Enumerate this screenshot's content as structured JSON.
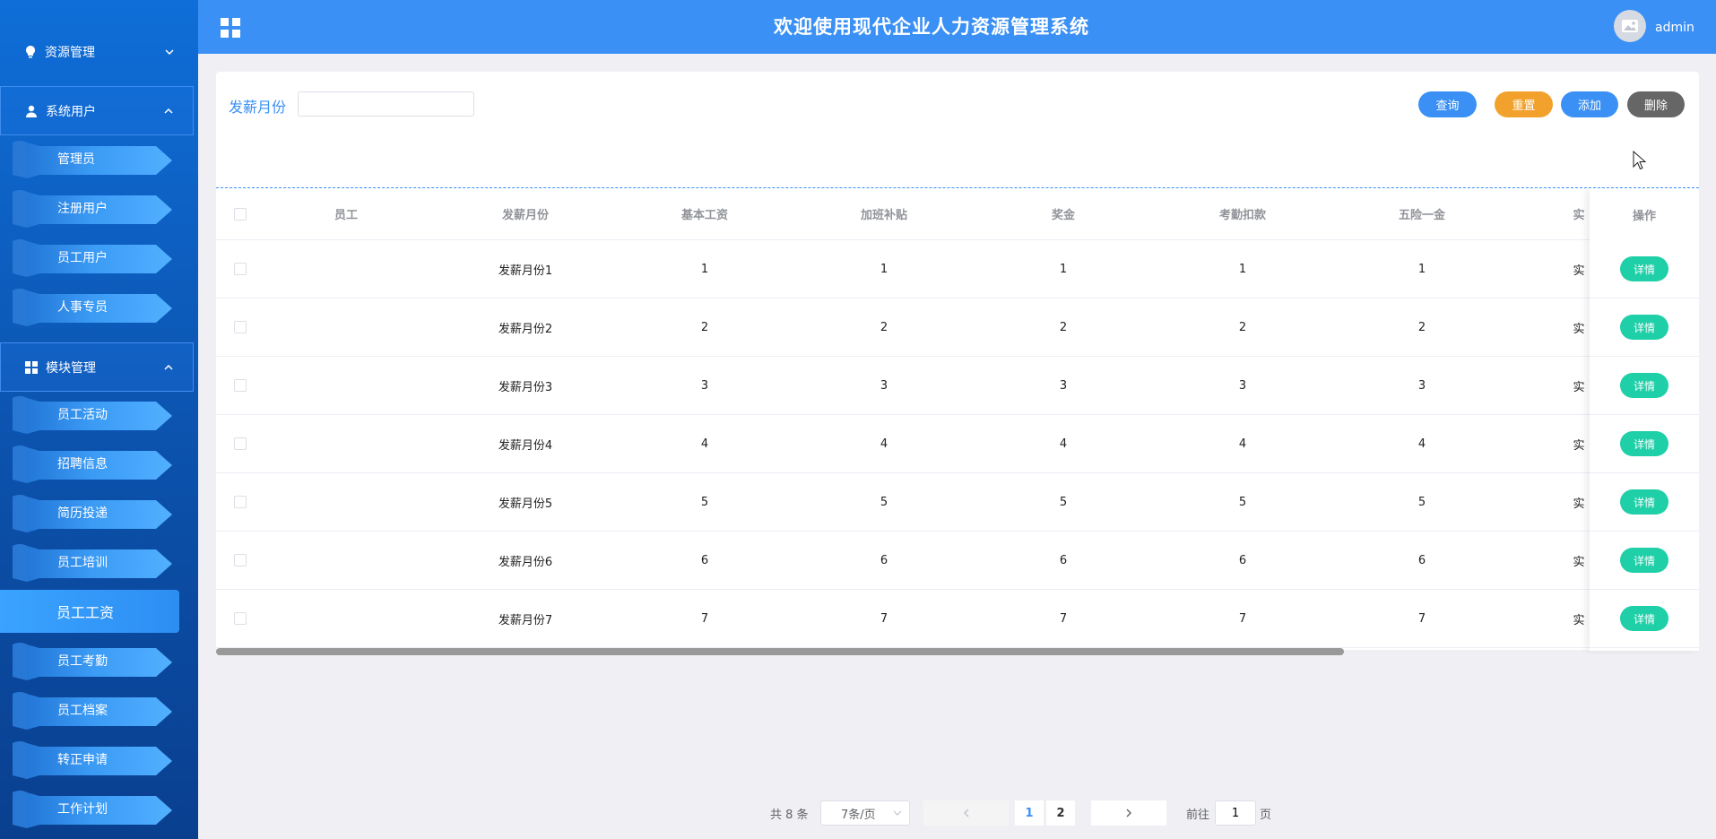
{
  "sidebar": {
    "groups": {
      "resource": "资源管理",
      "users": "系统用户",
      "modules": "模块管理"
    },
    "user_items": [
      "管理员",
      "注册用户",
      "员工用户",
      "人事专员"
    ],
    "module_items": [
      "员工活动",
      "招聘信息",
      "简历投递",
      "员工培训",
      "员工工资",
      "员工考勤",
      "员工档案",
      "转正申请",
      "工作计划"
    ],
    "active_item": "员工工资"
  },
  "header": {
    "title": "欢迎使用现代企业人力资源管理系统",
    "username": "admin"
  },
  "filter": {
    "label": "发薪月份",
    "value": ""
  },
  "buttons": {
    "query": "查询",
    "reset": "重置",
    "add": "添加",
    "delete": "删除"
  },
  "table": {
    "headers": [
      "员工",
      "发薪月份",
      "基本工资",
      "加班补贴",
      "奖金",
      "考勤扣款",
      "五险一金",
      "实"
    ],
    "action_header": "操作",
    "detail_label": "详情",
    "rows": [
      {
        "employee": "",
        "month": "发薪月份1",
        "base": "1",
        "overtime": "1",
        "bonus": "1",
        "deduction": "1",
        "insurance": "1",
        "actual": "实"
      },
      {
        "employee": "",
        "month": "发薪月份2",
        "base": "2",
        "overtime": "2",
        "bonus": "2",
        "deduction": "2",
        "insurance": "2",
        "actual": "实"
      },
      {
        "employee": "",
        "month": "发薪月份3",
        "base": "3",
        "overtime": "3",
        "bonus": "3",
        "deduction": "3",
        "insurance": "3",
        "actual": "实"
      },
      {
        "employee": "",
        "month": "发薪月份4",
        "base": "4",
        "overtime": "4",
        "bonus": "4",
        "deduction": "4",
        "insurance": "4",
        "actual": "实"
      },
      {
        "employee": "",
        "month": "发薪月份5",
        "base": "5",
        "overtime": "5",
        "bonus": "5",
        "deduction": "5",
        "insurance": "5",
        "actual": "实"
      },
      {
        "employee": "",
        "month": "发薪月份6",
        "base": "6",
        "overtime": "6",
        "bonus": "6",
        "deduction": "6",
        "insurance": "6",
        "actual": "实"
      },
      {
        "employee": "",
        "month": "发薪月份7",
        "base": "7",
        "overtime": "7",
        "bonus": "7",
        "deduction": "7",
        "insurance": "7",
        "actual": "实"
      }
    ]
  },
  "pagination": {
    "total": "共 8 条",
    "page_size": "7条/页",
    "pages": [
      "1",
      "2"
    ],
    "current": "1",
    "goto_label": "前往",
    "goto_value": "1",
    "page_suffix": "页"
  },
  "colors": {
    "primary": "#3a90f4",
    "warning": "#f2a12c",
    "danger": "#666666",
    "success": "#1fcfa8",
    "sidebar": "#0b4fa8"
  },
  "icons": {
    "resource": "lightbulb-icon",
    "users": "user-icon",
    "modules": "grid-icon",
    "header_menu": "grid-icon",
    "avatar": "image-icon"
  }
}
